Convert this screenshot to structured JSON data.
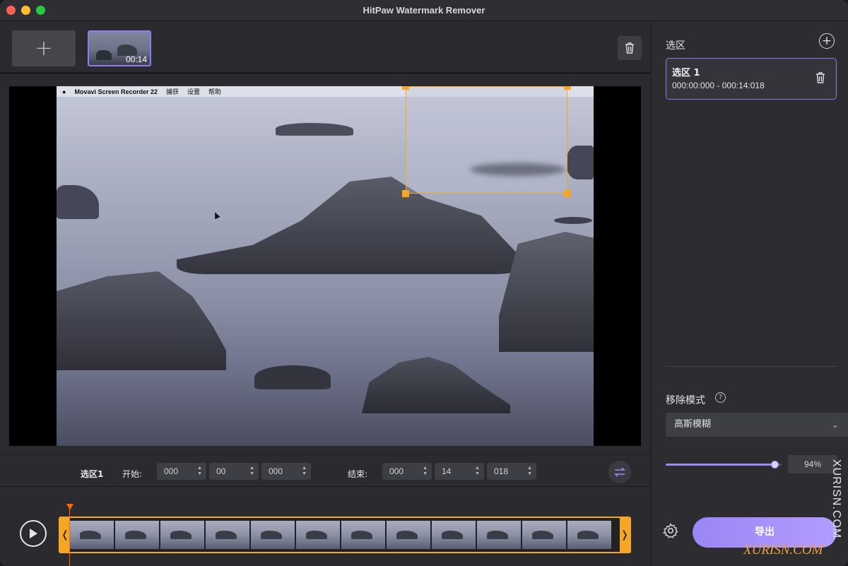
{
  "window": {
    "title": "HitPaw Watermark Remover"
  },
  "media": {
    "add_label": "+",
    "thumb_duration": "00:14"
  },
  "video": {
    "menubar": {
      "app_name": "Movavi Screen Recorder 22",
      "items": [
        "捕获",
        "设置",
        "帮助"
      ]
    }
  },
  "timebar": {
    "region_label": "选区1",
    "start_label": "开始:",
    "end_label": "结束:",
    "start": {
      "h": "000",
      "m": "00",
      "ms": "000"
    },
    "end": {
      "h": "000",
      "m": "14",
      "ms": "018"
    }
  },
  "timeline": {
    "left_grip": "❬",
    "right_grip": "❭",
    "frame_count": 12
  },
  "sidebar": {
    "title": "选区",
    "regions": [
      {
        "name": "选区 1",
        "range": "000:00:000 - 000:14:018"
      }
    ],
    "mode_title": "移除模式",
    "mode_value": "高斯模糊",
    "strength": {
      "value": 0.94,
      "label": "94%"
    },
    "export_label": "导出"
  },
  "watermarks": {
    "vertical": "XURISN.COM",
    "bottom": "XURISN.COM"
  },
  "colors": {
    "accent": "#8d7cf0",
    "selection": "#f5a623",
    "playhead": "#ff6a00"
  }
}
